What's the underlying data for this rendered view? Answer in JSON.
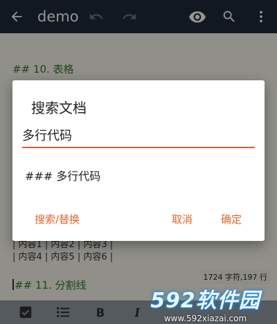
{
  "appbar": {
    "title": "demo",
    "icons": [
      "back-arrow-icon",
      "undo-icon",
      "redo-icon",
      "preview-eye-icon",
      "search-icon",
      "more-vert-icon"
    ]
  },
  "editor": {
    "heading_10": "## 10. 表格",
    "table_row_1": "| 内容1 | 内容2 | 内容3 |",
    "table_row_2": "| 内容4 | 内容5 | 内容6 |",
    "heading_11": "## 11. 分割线"
  },
  "dialog": {
    "title": "搜索文档",
    "input_value": "多行代码",
    "result_text": "### 多行代码",
    "search_replace_label": "搜索/替换",
    "cancel_label": "取消",
    "ok_label": "确定",
    "accent_color": "#e05b2f"
  },
  "status": {
    "count_text": "1724 字符,197 行"
  },
  "toolbar": {
    "icons": [
      "checkbox-icon",
      "bullet-list-icon",
      "bold-icon",
      "italic-icon"
    ]
  },
  "watermark": {
    "main": "592软件园",
    "sub": "www.592xiazai.com"
  }
}
